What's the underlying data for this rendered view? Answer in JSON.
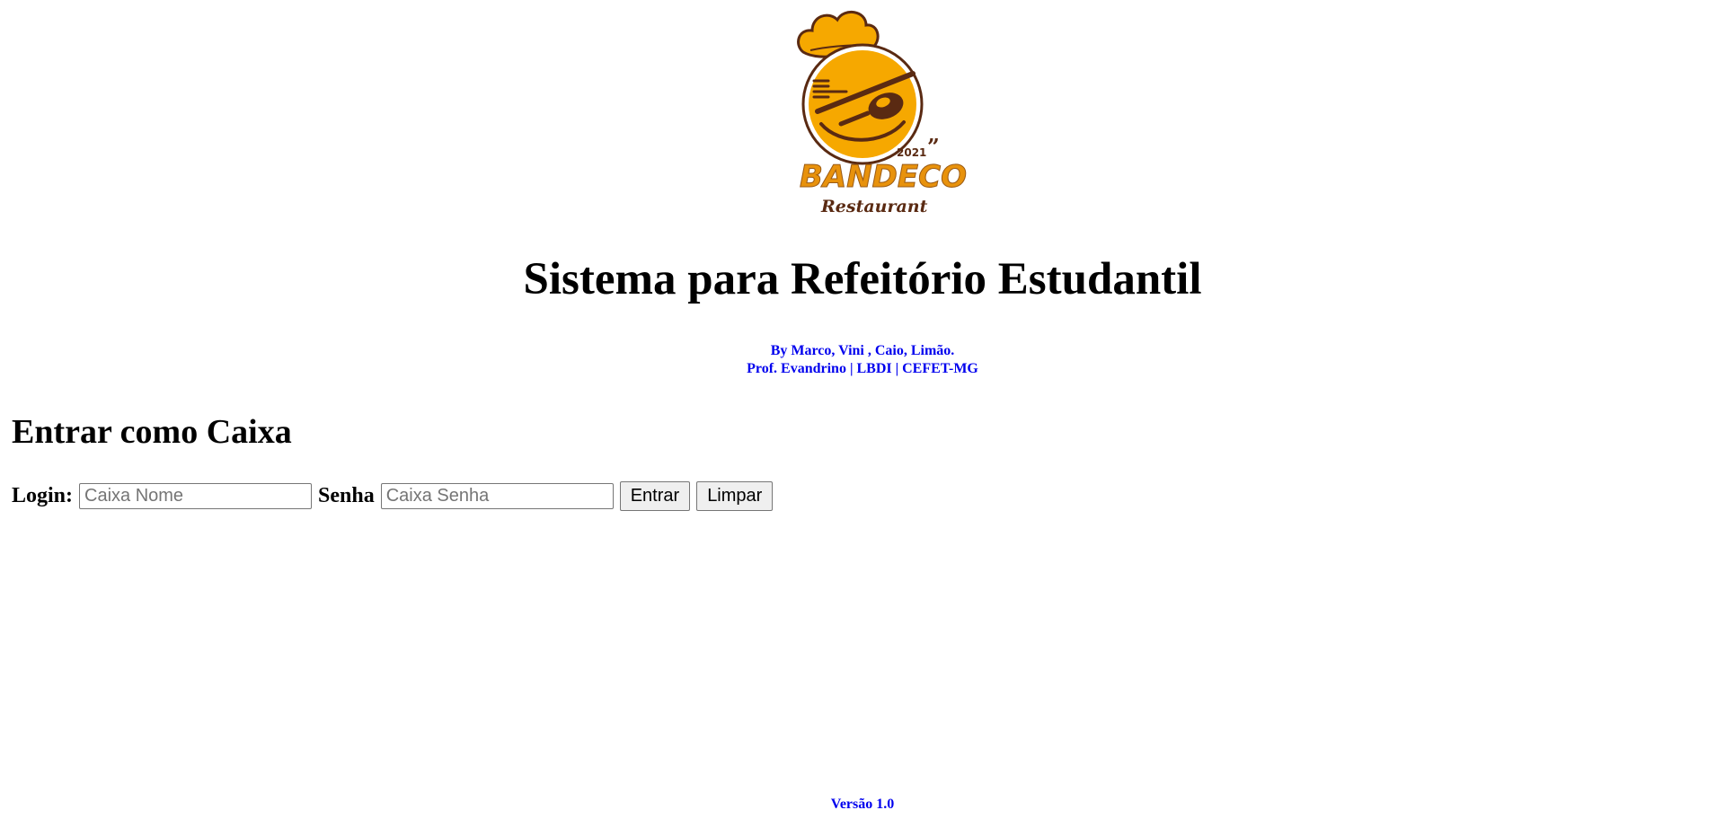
{
  "logo": {
    "brand": "BANDECO",
    "subtitle": "Restaurant",
    "year": "2021"
  },
  "header": {
    "title": "Sistema para Refeitório Estudantil",
    "authors": "By Marco, Vini , Caio, Limão.",
    "institution": "Prof. Evandrino | LBDI | CEFET-MG"
  },
  "login_section": {
    "title": "Entrar como Caixa",
    "login_label": "Login:",
    "login_placeholder": "Caixa Nome",
    "password_label": "Senha",
    "password_placeholder": "Caixa Senha",
    "submit_label": "Entrar",
    "clear_label": "Limpar"
  },
  "footer": {
    "version": "Versão 1.0"
  },
  "colors": {
    "link_blue": "#0000ee",
    "logo_orange": "#f6a800",
    "logo_brown": "#5a2a12"
  }
}
